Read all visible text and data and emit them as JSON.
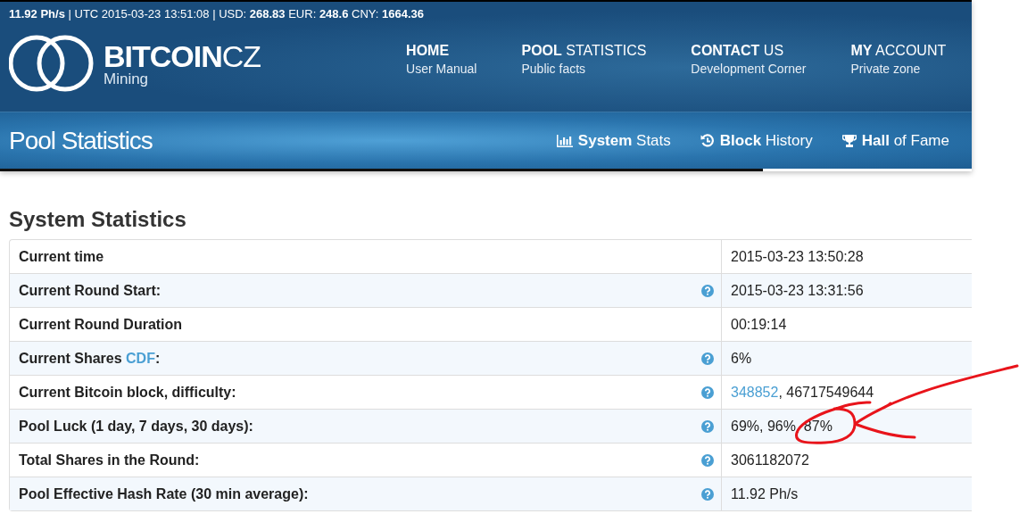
{
  "status_bar": {
    "text": "**11.92 Ph/s** | UTC 2015-03-23 13:51:08 | USD: **268.83** EUR: **248.6** CNY: **1664.36**"
  },
  "logo": {
    "name_bold_part": "BITCOIN",
    "name_light_part": "CZ",
    "subtitle": "Mining"
  },
  "nav": [
    {
      "title": "**HOME**",
      "subtitle": "User Manual"
    },
    {
      "title": "**POOL** STATISTICS",
      "subtitle": "Public facts"
    },
    {
      "title": "**CONTACT** US",
      "subtitle": "Development Corner"
    },
    {
      "title": "**MY** ACCOUNT",
      "subtitle": "Private zone"
    }
  ],
  "page_title": "Pool Statistics",
  "subnav": [
    {
      "kind": "chart",
      "label": "**System** Stats"
    },
    {
      "kind": "history",
      "label": "**Block** History"
    },
    {
      "kind": "trophy",
      "label": "**Hall** of Fame"
    }
  ],
  "section_title": "System Statistics",
  "rows": [
    {
      "label": "Current time",
      "help": false,
      "value": "2015-03-23 13:50:28"
    },
    {
      "label": "Current Round Start:",
      "help": true,
      "value": "2015-03-23 13:31:56"
    },
    {
      "label": "Current Round Duration",
      "help": false,
      "value": "00:19:14"
    },
    {
      "label": "Current Shares ",
      "label_link": "CDF",
      "label_end": ":",
      "help": true,
      "value": "6%"
    },
    {
      "label": "Current Bitcoin block, difficulty:",
      "help": true,
      "value_link": "348852",
      "value": ", 46717549644"
    },
    {
      "label": "Pool Luck (1 day, 7 days, 30 days):",
      "help": true,
      "value": "69%, 96%, 87%"
    },
    {
      "label": "Total Shares in the Round:",
      "help": true,
      "value": "3061182072"
    },
    {
      "label": "Pool Effective Hash Rate (30 min average):",
      "help": true,
      "value": "11.92 Ph/s"
    }
  ]
}
